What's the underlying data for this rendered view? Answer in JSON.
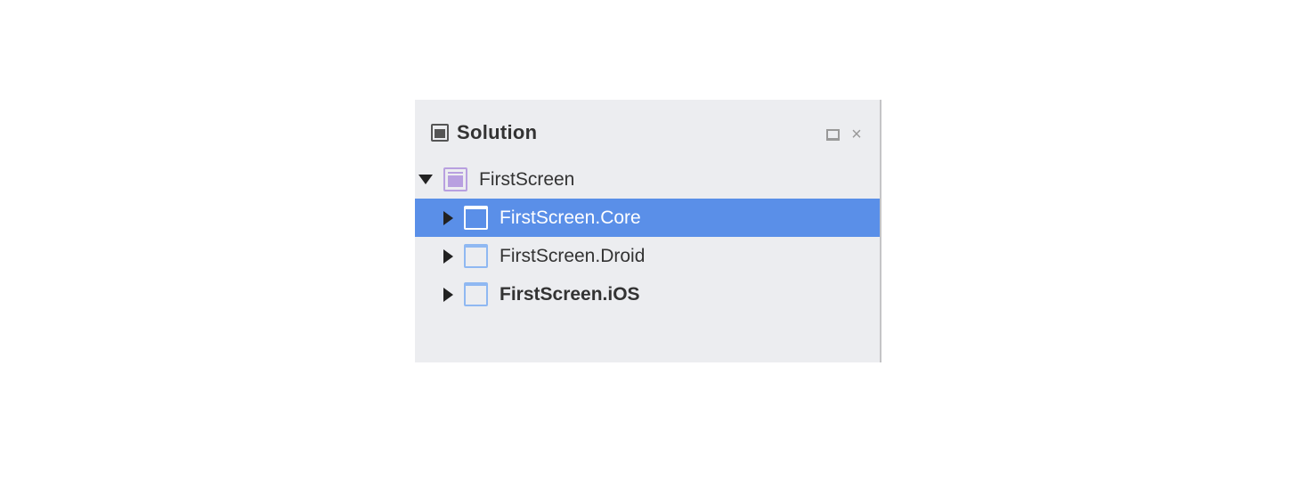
{
  "panel": {
    "title": "Solution",
    "maximize_icon": "maximize-icon",
    "close_icon": "close-icon"
  },
  "tree": {
    "root": {
      "label": "FirstScreen",
      "expanded": true,
      "icon": "solution-icon"
    },
    "children": [
      {
        "label": "FirstScreen.Core",
        "selected": true,
        "bold": false,
        "icon": "project-icon"
      },
      {
        "label": "FirstScreen.Droid",
        "selected": false,
        "bold": false,
        "icon": "project-icon"
      },
      {
        "label": "FirstScreen.iOS",
        "selected": false,
        "bold": true,
        "icon": "project-icon"
      }
    ]
  },
  "colors": {
    "selection": "#5a8fe8",
    "panel_bg": "#ecedf0"
  }
}
